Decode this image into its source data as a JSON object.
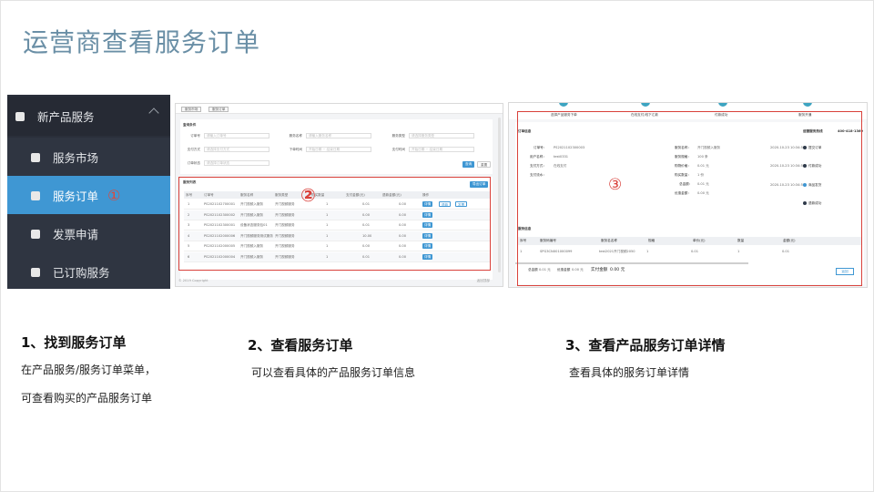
{
  "title": "运营商查看服务订单",
  "menu": {
    "parent": "新产品服务",
    "items": [
      {
        "label": "服务市场"
      },
      {
        "label": "服务订单"
      },
      {
        "label": "发票申请"
      },
      {
        "label": "已订购服务"
      }
    ],
    "marker": "①"
  },
  "list_screen": {
    "marker": "②",
    "tabs": [
      "服务市场",
      "服务订单"
    ],
    "filter_title": "查询条件",
    "filters": [
      {
        "label": "订单号",
        "placeholder": "请输入订单号"
      },
      {
        "label": "服务名称",
        "placeholder": "请输入服务名称"
      },
      {
        "label": "服务类型",
        "placeholder": "请选择服务类型"
      },
      {
        "label": "支付方式",
        "placeholder": "请选择支付方式"
      },
      {
        "label": "下单时间",
        "placeholder": "开始日期 ~ 结束日期"
      },
      {
        "label": "支付时间",
        "placeholder": "开始日期 ~ 结束日期"
      },
      {
        "label": "订单状态",
        "placeholder": "请选择订单状态"
      }
    ],
    "search_label": "查询",
    "reset_label": "重置",
    "list_title": "服务列表",
    "export_label": "导出订单",
    "columns": [
      "序号",
      "订单号",
      "服务名称",
      "服务类型",
      "购买数量",
      "支付金额(元)",
      "退款金额(元)",
      "操作"
    ],
    "rows": [
      {
        "no": "1",
        "order": "PS2021102700001",
        "name": "开门视频入服务",
        "type": "开门视频服务",
        "qty": "1",
        "pay": "0.01",
        "refund": "0.00",
        "actions": [
          "详情",
          "退款",
          "发票"
        ]
      },
      {
        "no": "2",
        "order": "PS2021102300002",
        "name": "开门视频入服务",
        "type": "开门视频服务",
        "qty": "1",
        "pay": "0.00",
        "refund": "0.00",
        "actions": [
          "详情"
        ]
      },
      {
        "no": "3",
        "order": "PS2021102300001",
        "name": "设备状态服务包01",
        "type": "开门视频服务",
        "qty": "1",
        "pay": "0.01",
        "refund": "0.00",
        "actions": [
          "详情"
        ]
      },
      {
        "no": "4",
        "order": "PS2021102000006",
        "name": "开门视频服务测试服务",
        "type": "开门视频服务",
        "qty": "1",
        "pay": "10.00",
        "refund": "0.00",
        "actions": [
          "详情"
        ]
      },
      {
        "no": "5",
        "order": "PS2021102000005",
        "name": "开门视频入服务",
        "type": "开门视频服务",
        "qty": "1",
        "pay": "0.00",
        "refund": "0.00",
        "actions": [
          "详情"
        ]
      },
      {
        "no": "6",
        "order": "PS2021102000004",
        "name": "开门视频入服务",
        "type": "开门视频服务",
        "qty": "1",
        "pay": "0.01",
        "refund": "0.00",
        "actions": [
          "详情"
        ]
      }
    ],
    "footer_left": "© 2019 Copyright",
    "footer_right": "返回顶部"
  },
  "detail_screen": {
    "marker": "③",
    "steps": [
      "选择产品服务下单",
      "在线支付/线下汇款",
      "付款成功",
      "服务开通"
    ],
    "section_title": "订单信息",
    "hotline_label": "运营服务热线",
    "hotline": "400-418-1369",
    "left_fields": [
      {
        "label": "订单号：",
        "value": "PS2021102300003"
      },
      {
        "label": "用户名称：",
        "value": "test0331"
      },
      {
        "label": "支付方式：",
        "value": "在线支付"
      },
      {
        "label": "支付流水：",
        "value": ""
      }
    ],
    "mid_fields": [
      {
        "label": "服务名称：",
        "value": "开门视频入服务"
      },
      {
        "label": "服务规格：",
        "value": "100 条"
      },
      {
        "label": "购物价格：",
        "value": "0.01 元"
      },
      {
        "label": "购买数量：",
        "value": "1 份"
      },
      {
        "label": "总金额：",
        "value": "0.01 元"
      },
      {
        "label": "优惠金额：",
        "value": "0.00 元"
      }
    ],
    "timeline": [
      {
        "time": "2020-10-23 10:34:58",
        "label": "提交订单"
      },
      {
        "time": "2020-10-23 10:34:58",
        "label": "付款成功"
      },
      {
        "time": "2020-10-23 10:34:58",
        "label": "商品发货"
      },
      {
        "time": "",
        "label": "退款成功"
      }
    ],
    "goods_title": "服务信息",
    "goods_columns": [
      "序号",
      "服务码编号",
      "服务名名称",
      "规格",
      "单价(元)",
      "数量",
      "金额(元)"
    ],
    "goods_row": {
      "no": "1",
      "code": "SPG3CNX01000099",
      "name": "test2021开门视频2050",
      "spec": "1",
      "price": "0.01",
      "qty": "1",
      "amount": "0.01"
    },
    "total_label": "总金额",
    "total_value": "0.01 元",
    "discount_label": "优惠金额",
    "discount_value": "0.00 元",
    "paid_label": "实付金额",
    "paid_value": "0.00 元",
    "back_label": "返回"
  },
  "steps": [
    {
      "head": "1、找到服务订单",
      "desc": [
        "在产品服务/服务订单菜单，",
        "可查看购买的产品服务订单"
      ]
    },
    {
      "head": "2、查看服务订单",
      "desc": [
        "可以查看具体的产品服务订单信息"
      ]
    },
    {
      "head": "3、查看产品服务订单详情",
      "desc": [
        "查看具体的服务订单详情"
      ]
    }
  ],
  "colors": {
    "accent": "#3f97d3",
    "title": "#6a8fa6",
    "marker": "#d9413b",
    "sidebar": "#2a2f3a"
  }
}
